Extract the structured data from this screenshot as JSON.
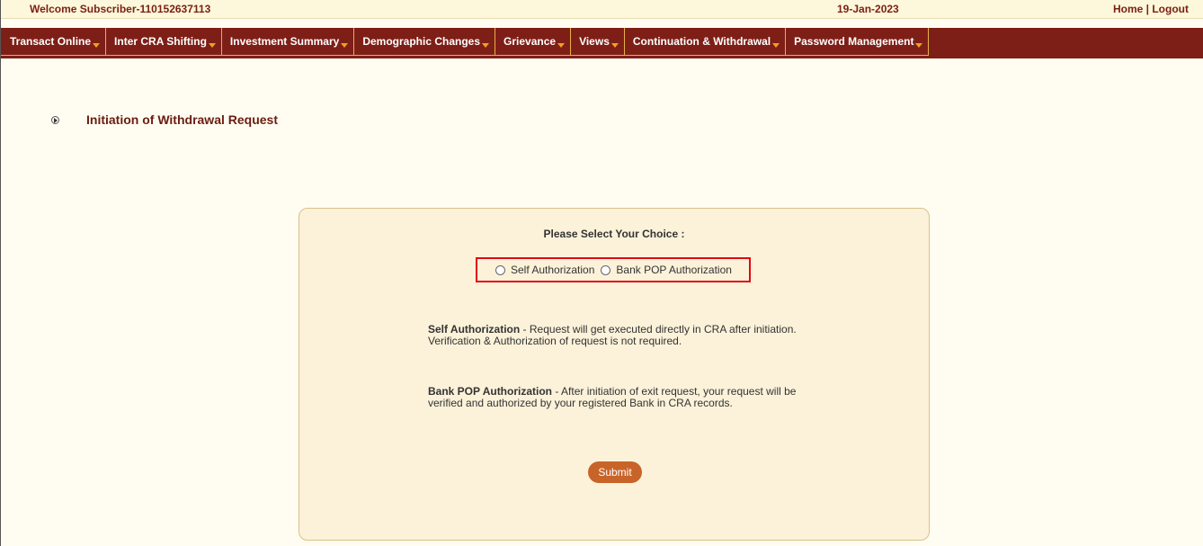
{
  "topbar": {
    "welcome": "Welcome Subscriber-110152637113",
    "date": "19-Jan-2023",
    "home": "Home",
    "separator": " | ",
    "logout": "Logout"
  },
  "nav": {
    "items": [
      {
        "label": "Transact Online"
      },
      {
        "label": "Inter CRA Shifting"
      },
      {
        "label": "Investment Summary"
      },
      {
        "label": "Demographic Changes"
      },
      {
        "label": "Grievance"
      },
      {
        "label": "Views"
      },
      {
        "label": "Continuation & Withdrawal"
      },
      {
        "label": "Password Management"
      }
    ]
  },
  "page": {
    "title": "Initiation of Withdrawal Request"
  },
  "form": {
    "choice_label": "Please Select Your Choice :",
    "options": [
      {
        "label": "Self Authorization"
      },
      {
        "label": "Bank POP Authorization"
      }
    ],
    "descriptions": [
      {
        "term": "Self Authorization",
        "text": " - Request will get executed directly in CRA after initiation. Verification & Authorization of request is not required."
      },
      {
        "term": "Bank POP Authorization",
        "text": " - After initiation of exit request, your request will be verified and authorized by your registered Bank in CRA records."
      }
    ],
    "submit_label": "Submit"
  },
  "colors": {
    "nav_bg": "#7e1f17",
    "accent": "#c8642a",
    "highlight_border": "#e30613"
  }
}
